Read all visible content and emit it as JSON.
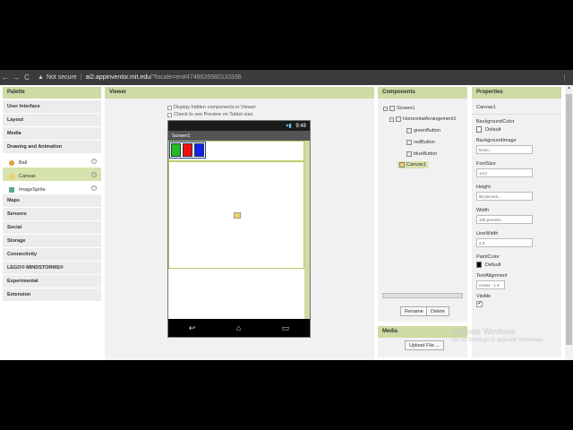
{
  "browser": {
    "not_secure": "Not secure",
    "url_host": "ai2.appinventor.mit.edu",
    "url_rest": "/?locale=en#4748626980110336",
    "back_icon": "←",
    "forward_icon": "→",
    "reload_icon": "C",
    "warning_icon": "▲",
    "menu_icon": "⋮"
  },
  "palette": {
    "title": "Palette",
    "categories_top": [
      "User Interface",
      "Layout",
      "Media",
      "Drawing and Animation"
    ],
    "items": [
      {
        "label": "Ball",
        "color": "#e0a030",
        "selected": false
      },
      {
        "label": "Canvas",
        "color": "#f0d070",
        "selected": true
      },
      {
        "label": "ImageSprite",
        "color": "#5a9",
        "selected": false
      }
    ],
    "categories_bottom": [
      "Maps",
      "Sensors",
      "Social",
      "Storage",
      "Connectivity",
      "LEGO® MINDSTORMS®",
      "Experimental",
      "Extension"
    ],
    "help": "?"
  },
  "viewer": {
    "title": "Viewer",
    "checkbox1": "Display hidden components in Viewer",
    "checkbox2": "Check to see Preview on Tablet size.",
    "status_time": "9:48",
    "screen_title": "Screen1",
    "buttons": [
      {
        "color": "#22bb22"
      },
      {
        "color": "#ee1111"
      },
      {
        "color": "#1122ee"
      }
    ],
    "nav_back": "↩",
    "nav_home": "⌂",
    "nav_recent": "▭"
  },
  "components": {
    "title": "Components",
    "tree": [
      {
        "label": "Screen1",
        "toggle": "−"
      },
      {
        "label": "HorizontalArrangement1",
        "toggle": "−"
      },
      {
        "label": "greenButton"
      },
      {
        "label": "redButton"
      },
      {
        "label": "blueButton"
      },
      {
        "label": "Canvas1",
        "selected": true
      }
    ],
    "rename": "Rename",
    "delete": "Delete"
  },
  "media": {
    "title": "Media",
    "upload": "Upload File ..."
  },
  "properties": {
    "title": "Properties",
    "component": "Canvas1",
    "background_color_label": "BackgroundColor",
    "background_color_value": "Default",
    "background_image_label": "BackgroundImage",
    "background_image_value": "None...",
    "font_size_label": "FontSize",
    "font_size_value": "14.0",
    "height_label": "Height",
    "height_value": "60 percent...",
    "width_label": "Width",
    "width_value": "100 percent...",
    "line_width_label": "LineWidth",
    "line_width_value": "2.0",
    "paint_color_label": "PaintColor",
    "paint_color_value": "Default",
    "text_alignment_label": "TextAlignment",
    "text_alignment_value": "center : 1 ▾",
    "visible_label": "Visible",
    "visible_check": "✔"
  },
  "watermark": {
    "line1": "Activate Windows",
    "line2": "Go to Settings to activate Windows."
  }
}
